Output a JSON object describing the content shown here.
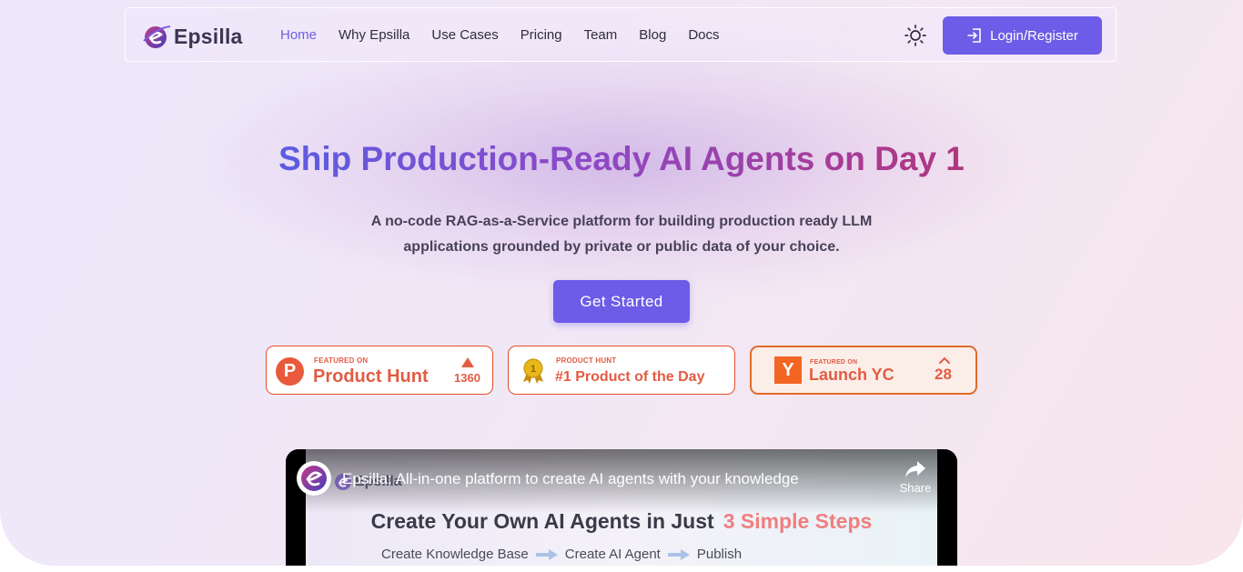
{
  "brand": {
    "name": "Epsilla"
  },
  "nav": {
    "links": [
      {
        "label": "Home",
        "active": true
      },
      {
        "label": "Why Epsilla",
        "active": false
      },
      {
        "label": "Use Cases",
        "active": false
      },
      {
        "label": "Pricing",
        "active": false
      },
      {
        "label": "Team",
        "active": false
      },
      {
        "label": "Blog",
        "active": false
      },
      {
        "label": "Docs",
        "active": false
      }
    ],
    "theme_icon": "sun-icon",
    "login_label": "Login/Register"
  },
  "hero": {
    "headline": "Ship Production-Ready AI Agents on Day 1",
    "subtitle_line1": "A no-code RAG-as-a-Service platform for building production ready LLM",
    "subtitle_line2": "applications grounded by private or public data of your choice.",
    "cta_label": "Get Started"
  },
  "badges": {
    "product_hunt": {
      "small": "FEATURED ON",
      "big": "Product Hunt",
      "count": "1360",
      "letter": "P"
    },
    "product_of_day": {
      "small": "PRODUCT HUNT",
      "big": "#1 Product of the Day",
      "medal": "1"
    },
    "launch_yc": {
      "small": "FEATURED ON",
      "big": "Launch YC",
      "count": "28",
      "letter": "Y"
    }
  },
  "video": {
    "title": "Epsilla: All-in-one platform to create AI agents with your knowledge",
    "share_label": "Share",
    "slide_logo": "Epsilla",
    "slide_title": "Create Your Own AI Agents in Just",
    "slide_title_accent": "3 Simple Steps",
    "steps": [
      "Create Knowledge Base",
      "Create AI Agent",
      "Publish"
    ]
  },
  "colors": {
    "accent": "#6c5ce7",
    "badge_orange": "#e25c43",
    "yc_orange": "#f26522"
  }
}
